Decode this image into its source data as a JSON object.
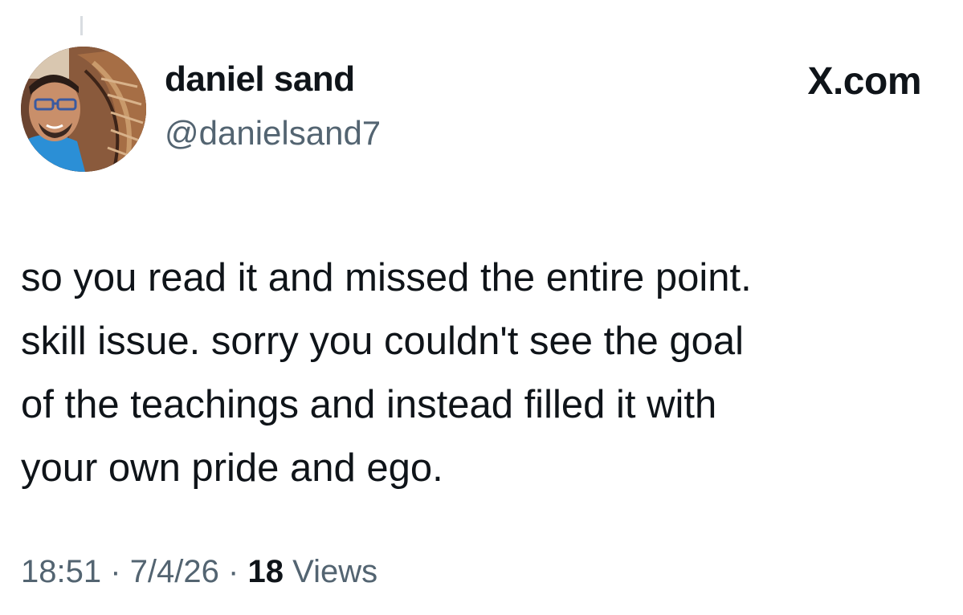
{
  "author": {
    "name": "daniel sand",
    "handle": "@danielsand7",
    "avatar_icon": "profile-photo"
  },
  "brand": {
    "label": "X.com"
  },
  "tweet": {
    "text": "so you read it and missed the entire point.\nskill issue.  sorry you couldn't see the goal\nof the teachings and instead filled it with\nyour own pride and ego.",
    "time": "18:51",
    "separator": "·",
    "date": "7/4/26",
    "views_count": "18",
    "views_label": "Views"
  },
  "colors": {
    "text_primary": "#0f1419",
    "text_secondary": "#536471",
    "background": "#ffffff"
  }
}
